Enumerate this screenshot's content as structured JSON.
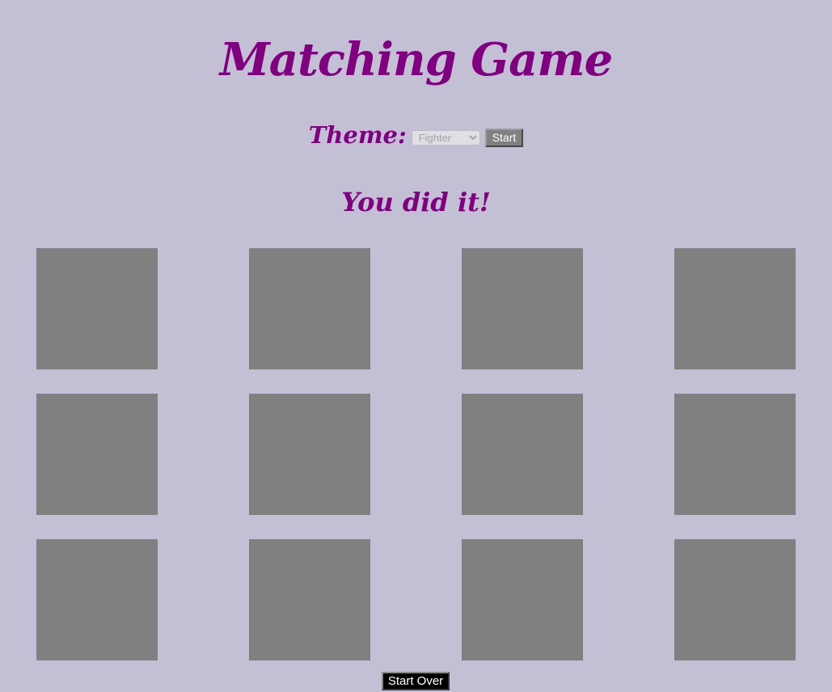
{
  "header": {
    "title": "Matching Game"
  },
  "controls": {
    "theme_label": "Theme:",
    "theme_select": {
      "selected": "Fighter",
      "options": [
        "Fighter"
      ]
    },
    "start_label": "Start"
  },
  "status": {
    "message": "You did it!"
  },
  "board": {
    "rows": 3,
    "columns": 4,
    "cards": [
      {
        "face": "down"
      },
      {
        "face": "down"
      },
      {
        "face": "down"
      },
      {
        "face": "down"
      },
      {
        "face": "down"
      },
      {
        "face": "down"
      },
      {
        "face": "down"
      },
      {
        "face": "down"
      },
      {
        "face": "down"
      },
      {
        "face": "down"
      },
      {
        "face": "down"
      },
      {
        "face": "down"
      }
    ]
  },
  "footer": {
    "start_over_label": "Start Over"
  },
  "colors": {
    "background": "#c3c0d6",
    "accent": "#800080",
    "card_back": "#808080",
    "start_over_bg": "#000000"
  }
}
